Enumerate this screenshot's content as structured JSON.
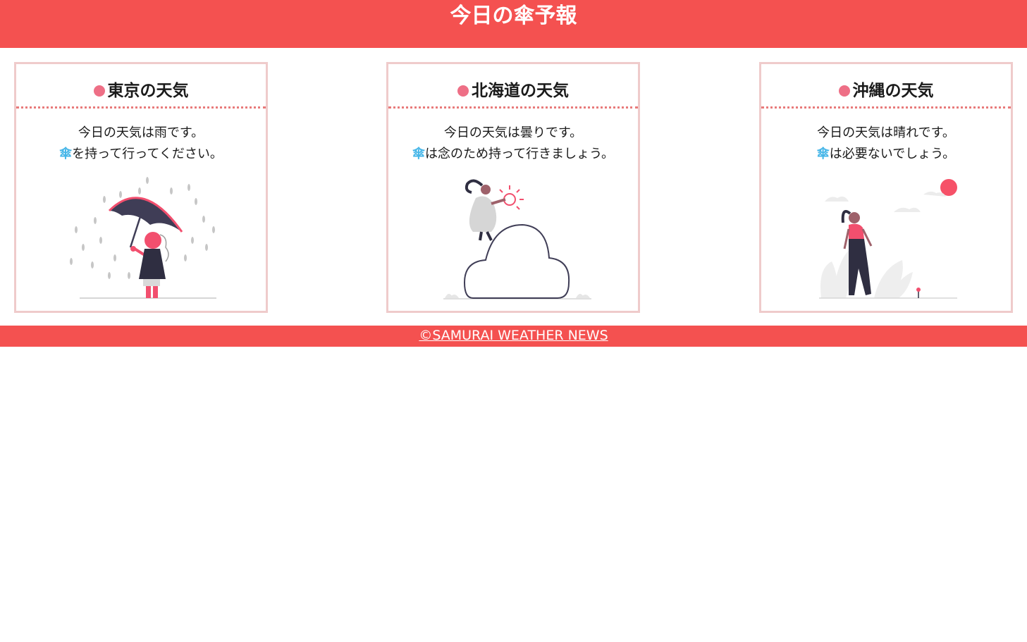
{
  "header": {
    "title": "今日の傘予報"
  },
  "colors": {
    "brand": "#f45150",
    "card_border": "#efcbcb",
    "dotted_line": "#e87a7a",
    "title_dot": "#ee6f86",
    "umbrella_glyph": "#46b6e8"
  },
  "cards": [
    {
      "title": "東京の天気",
      "line1": "今日の天気は雨です。",
      "umbrella": "傘",
      "line2": "を持って行ってください。",
      "illustration": "person-with-umbrella-in-rain"
    },
    {
      "title": "北海道の天気",
      "line1": "今日の天気は曇りです。",
      "umbrella": "傘",
      "line2": "は念のため持って行きましょう。",
      "illustration": "person-sitting-on-cloud-with-sun"
    },
    {
      "title": "沖縄の天気",
      "line1": "今日の天気は晴れです。",
      "umbrella": "傘",
      "line2": "は必要ないでしょう。",
      "illustration": "person-walking-in-sunshine"
    }
  ],
  "footer": {
    "copyright": "©SAMURAI WEATHER NEWS"
  }
}
